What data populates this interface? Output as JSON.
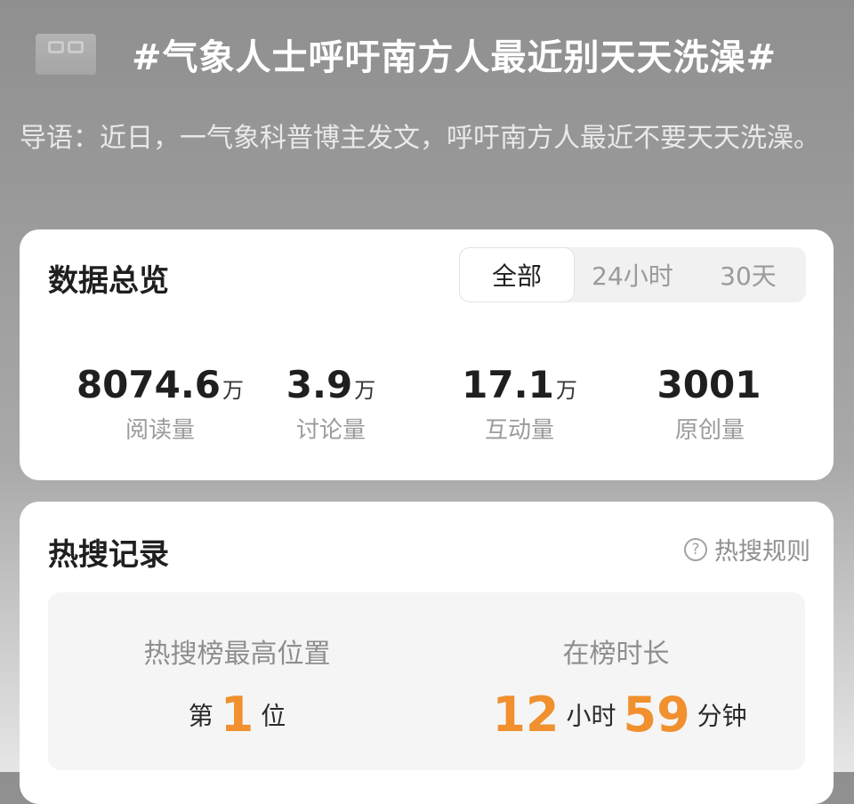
{
  "header": {
    "thumbnail_icon": "thumbnail-image-icon",
    "topic_title": "#气象人士呼吁南方人最近别天天洗澡#",
    "intro": "导语：近日，一气象科普博主发文，呼吁南方人最近不要天天洗澡。"
  },
  "overview": {
    "title": "数据总览",
    "tabs": [
      {
        "label": "全部",
        "active": true
      },
      {
        "label": "24小时",
        "active": false
      },
      {
        "label": "30天",
        "active": false
      }
    ],
    "stats": [
      {
        "value": "8074.6",
        "unit": "万",
        "label": "阅读量"
      },
      {
        "value": "3.9",
        "unit": "万",
        "label": "讨论量"
      },
      {
        "value": "17.1",
        "unit": "万",
        "label": "互动量"
      },
      {
        "value": "3001",
        "unit": "",
        "label": "原创量"
      }
    ]
  },
  "hot_search": {
    "title": "热搜记录",
    "rules_label": "热搜规则",
    "rules_icon": "question-circle-icon",
    "peak": {
      "label": "热搜榜最高位置",
      "prefix": "第",
      "value": "1",
      "suffix": "位"
    },
    "duration": {
      "label": "在榜时长",
      "hours": "12",
      "hours_unit": "小时",
      "minutes": "59",
      "minutes_unit": "分钟"
    }
  },
  "colors": {
    "accent": "#f0902e",
    "card_bg": "#ffffff",
    "panel_bg": "#f5f5f5",
    "muted_text": "#9b9b9b"
  }
}
